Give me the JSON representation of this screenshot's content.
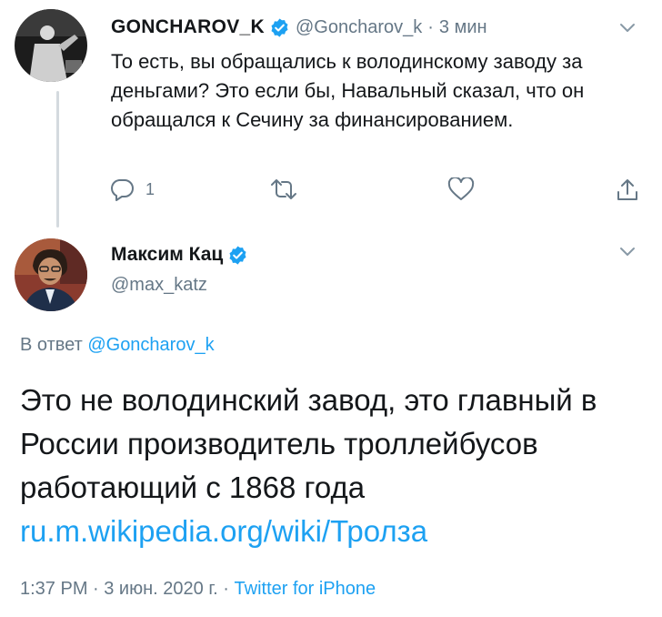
{
  "tweet1": {
    "name": "GONCHAROV_K",
    "handle": "@Goncharov_k",
    "time": "3 мин",
    "text": "То есть, вы обращались к володинскому заводу за деньгами? Это если бы, Навальный сказал, что он обращался к Сечину за финансированием.",
    "actions": {
      "reply_icon": "reply-icon",
      "reply_count": "1",
      "retweet_icon": "retweet-icon",
      "like_icon": "heart-icon",
      "share_icon": "share-icon"
    }
  },
  "tweet2": {
    "name": "Максим Кац",
    "handle": "@max_katz",
    "reply_prefix": "В ответ",
    "reply_mention": "@Goncharov_k",
    "text": "Это не володинский завод, это главный в России производитель троллейбусов работающий с 1868 года",
    "link": "ru.m.wikipedia.org/wiki/Тролза",
    "timestamp": "1:37 PM · 3 июн. 2020 г. ·",
    "source": "Twitter for iPhone"
  },
  "colors": {
    "accent": "#1da1f2",
    "secondary_text": "#657786",
    "primary_text": "#14171a",
    "thread_line": "#d4dadf"
  }
}
